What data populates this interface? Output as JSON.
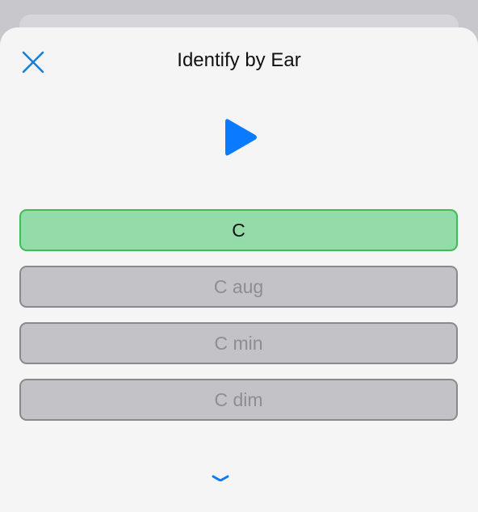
{
  "header": {
    "title": "Identify by Ear",
    "close_icon": "close-x-icon",
    "close_color": "#1a7fd4"
  },
  "player": {
    "play_icon": "play-triangle-icon",
    "play_color": "#0a7aff"
  },
  "options": [
    {
      "label": "C",
      "state": "correct"
    },
    {
      "label": "C aug",
      "state": "disabled"
    },
    {
      "label": "C min",
      "state": "disabled"
    },
    {
      "label": "C dim",
      "state": "disabled"
    }
  ],
  "colors": {
    "correct_fill": "#93dba8",
    "correct_border": "#3cbc5b",
    "disabled_fill": "#c3c3c7",
    "disabled_border": "#8a8a8e",
    "sheet_bg": "#f5f5f5"
  }
}
